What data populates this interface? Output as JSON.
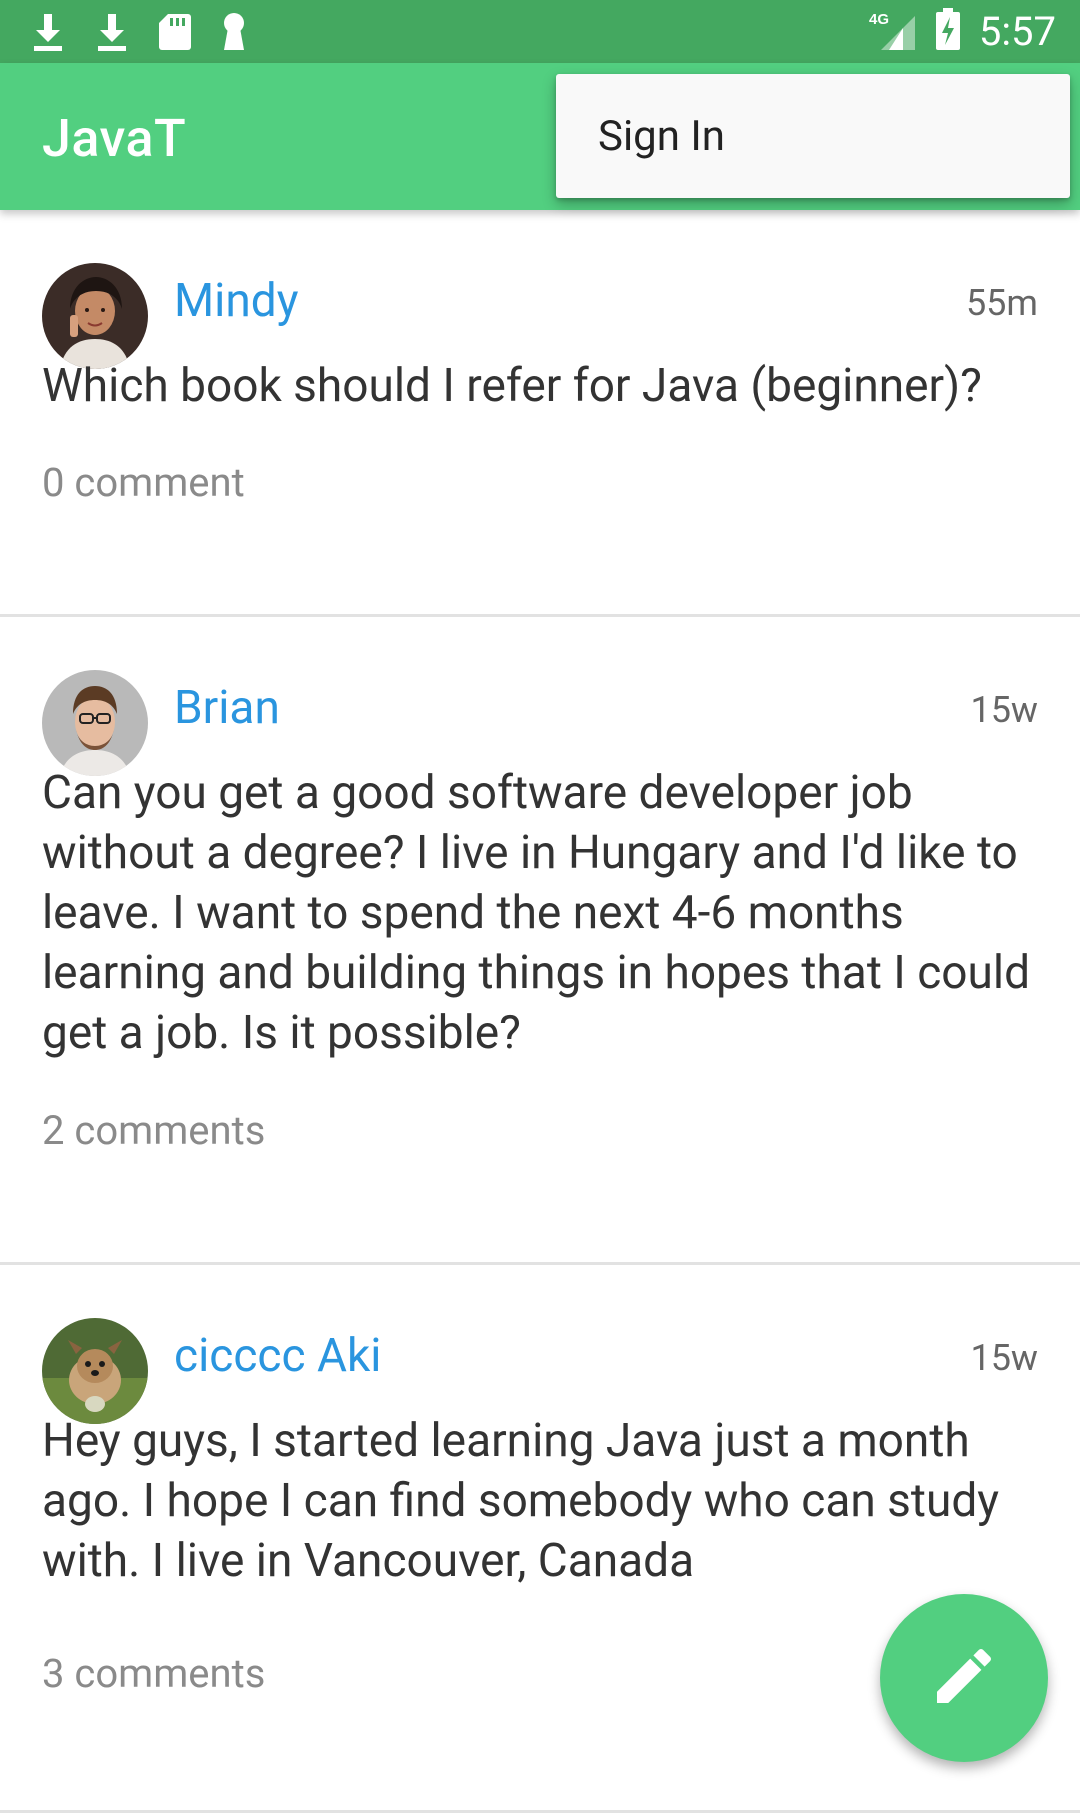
{
  "status_bar": {
    "time": "5:57",
    "network": "4G",
    "icons": [
      "download-icon",
      "download-icon",
      "sd-card-icon",
      "keyhole-icon",
      "signal-icon",
      "battery-charging-icon"
    ]
  },
  "app_bar": {
    "title": "JavaT"
  },
  "overflow_menu": {
    "items": [
      {
        "label": "Sign In"
      }
    ]
  },
  "posts": [
    {
      "author": "Mindy",
      "time": "55m",
      "text": "Which book should I refer for Java (beginner)?",
      "comments": "0 comment"
    },
    {
      "author": "Brian",
      "time": "15w",
      "text": "Can you get a good software developer job without a degree? I live in Hungary and I'd like to leave. I want to spend the next 4-6 months learning and building things in hopes that I could get a job. Is it possible?",
      "comments": "2 comments"
    },
    {
      "author": "cicccc Aki",
      "time": "15w",
      "text": "Hey guys, I started learning Java just a month ago. I hope I can find somebody who can study with. I live in Vancouver, Canada",
      "comments": "3 comments"
    }
  ],
  "fab": {
    "icon": "pencil-icon"
  },
  "colors": {
    "status_bar": "#44a860",
    "app_bar": "#52cf80",
    "author": "#2a95df",
    "fab": "#52cf80"
  }
}
